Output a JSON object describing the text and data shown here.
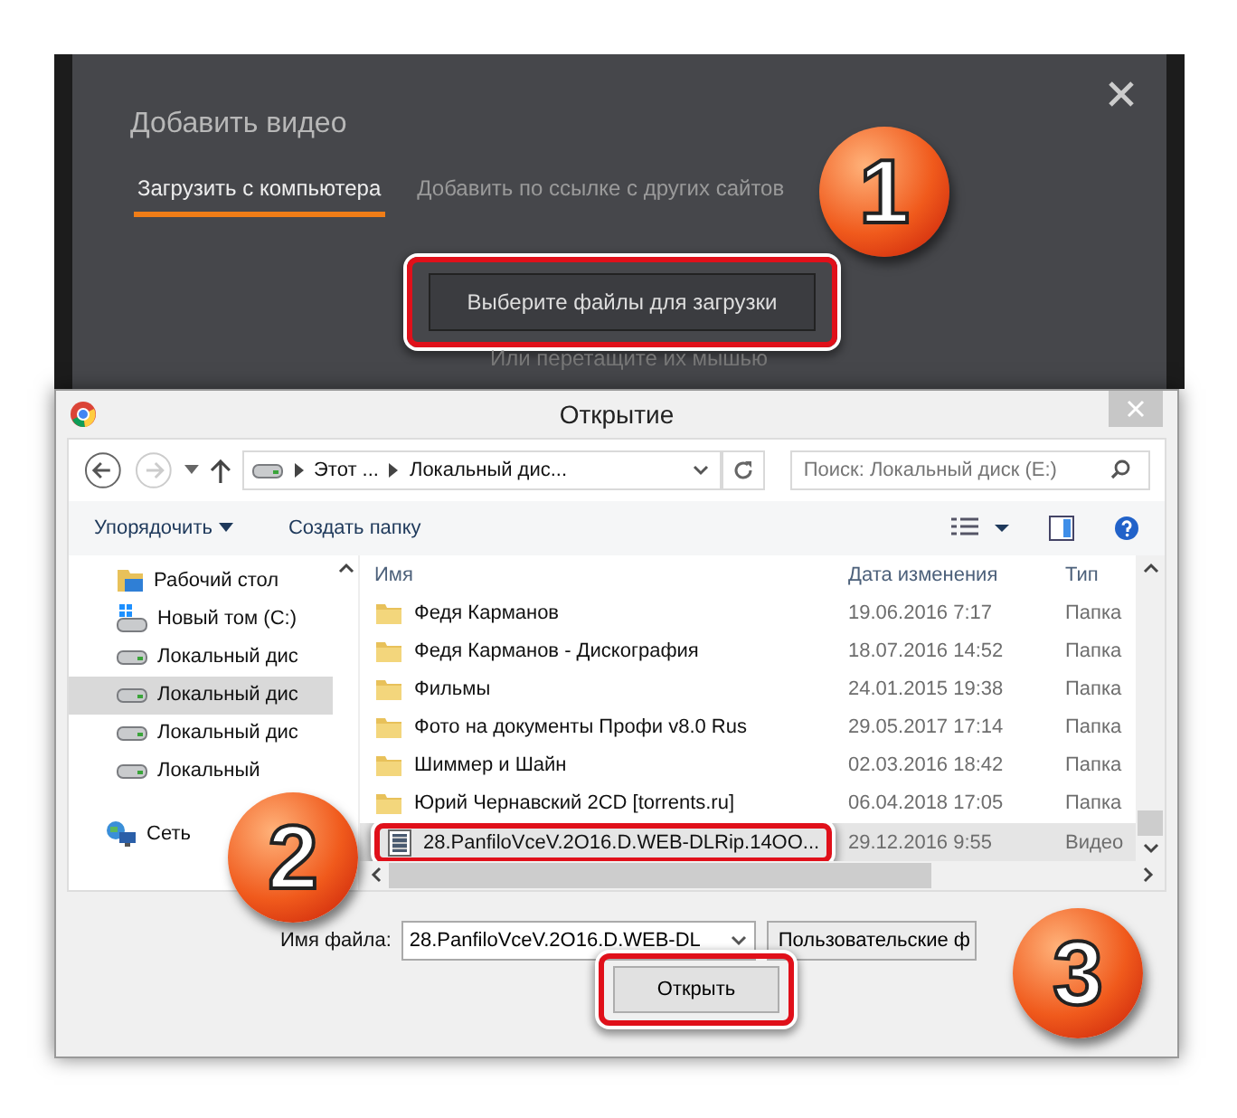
{
  "upload_panel": {
    "title": "Добавить видео",
    "tabs": [
      {
        "label": "Загрузить с компьютера",
        "selected": true
      },
      {
        "label": "Добавить по ссылке с других сайтов",
        "selected": false
      }
    ],
    "button": "Выберите файлы для загрузки",
    "hint": "Или перетащите их мышью"
  },
  "dialog": {
    "title": "Открытие",
    "address": [
      "Этот ...",
      "Локальный дис..."
    ],
    "search": {
      "placeholder": "Поиск: Локальный диск (E:)"
    },
    "toolbar": {
      "organize": "Упорядочить",
      "new_folder": "Создать папку"
    },
    "sidebar": {
      "items": [
        {
          "label": "Рабочий стол",
          "kind": "desktop",
          "selected": false
        },
        {
          "label": "Новый том (C:)",
          "kind": "system-drive",
          "selected": false
        },
        {
          "label": "Локальный дис",
          "kind": "drive",
          "selected": false
        },
        {
          "label": "Локальный дис",
          "kind": "drive",
          "selected": true
        },
        {
          "label": "Локальный дис",
          "kind": "drive",
          "selected": false
        },
        {
          "label": "Локальный",
          "kind": "drive",
          "selected": false
        },
        {
          "label": "Сеть",
          "kind": "network",
          "selected": false
        }
      ]
    },
    "table": {
      "columns": [
        "Имя",
        "Дата изменения",
        "Тип"
      ],
      "rows": [
        {
          "name": "Федя Карманов",
          "date": "19.06.2016 7:17",
          "type": "Папка",
          "kind": "folder",
          "selected": false
        },
        {
          "name": "Федя Карманов - Дискография",
          "date": "18.07.2016 14:52",
          "type": "Папка",
          "kind": "folder",
          "selected": false
        },
        {
          "name": "Фильмы",
          "date": "24.01.2015 19:38",
          "type": "Папка",
          "kind": "folder",
          "selected": false
        },
        {
          "name": "Фото на документы Профи v8.0 Rus",
          "date": "29.05.2017 17:14",
          "type": "Папка",
          "kind": "folder",
          "selected": false
        },
        {
          "name": "Шиммер и Шайн",
          "date": "02.03.2016 18:42",
          "type": "Папка",
          "kind": "folder",
          "selected": false
        },
        {
          "name": "Юрий Чернавский 2CD [torrents.ru]",
          "date": "06.04.2018 17:05",
          "type": "Папка",
          "kind": "folder",
          "selected": false
        },
        {
          "name": "28.PanfiloVceV.2O16.D.WEB-DLRip.14OO...",
          "date": "29.12.2016 9:55",
          "type": "Видео",
          "kind": "video",
          "selected": true
        }
      ]
    },
    "filename_label": "Имя файла:",
    "filename": "28.PanfiloVceV.2O16.D.WEB-DL",
    "filter": "Пользовательские ф",
    "open_button": "Открыть"
  },
  "annotations": [
    {
      "number": "1"
    },
    {
      "number": "2"
    },
    {
      "number": "3"
    }
  ]
}
